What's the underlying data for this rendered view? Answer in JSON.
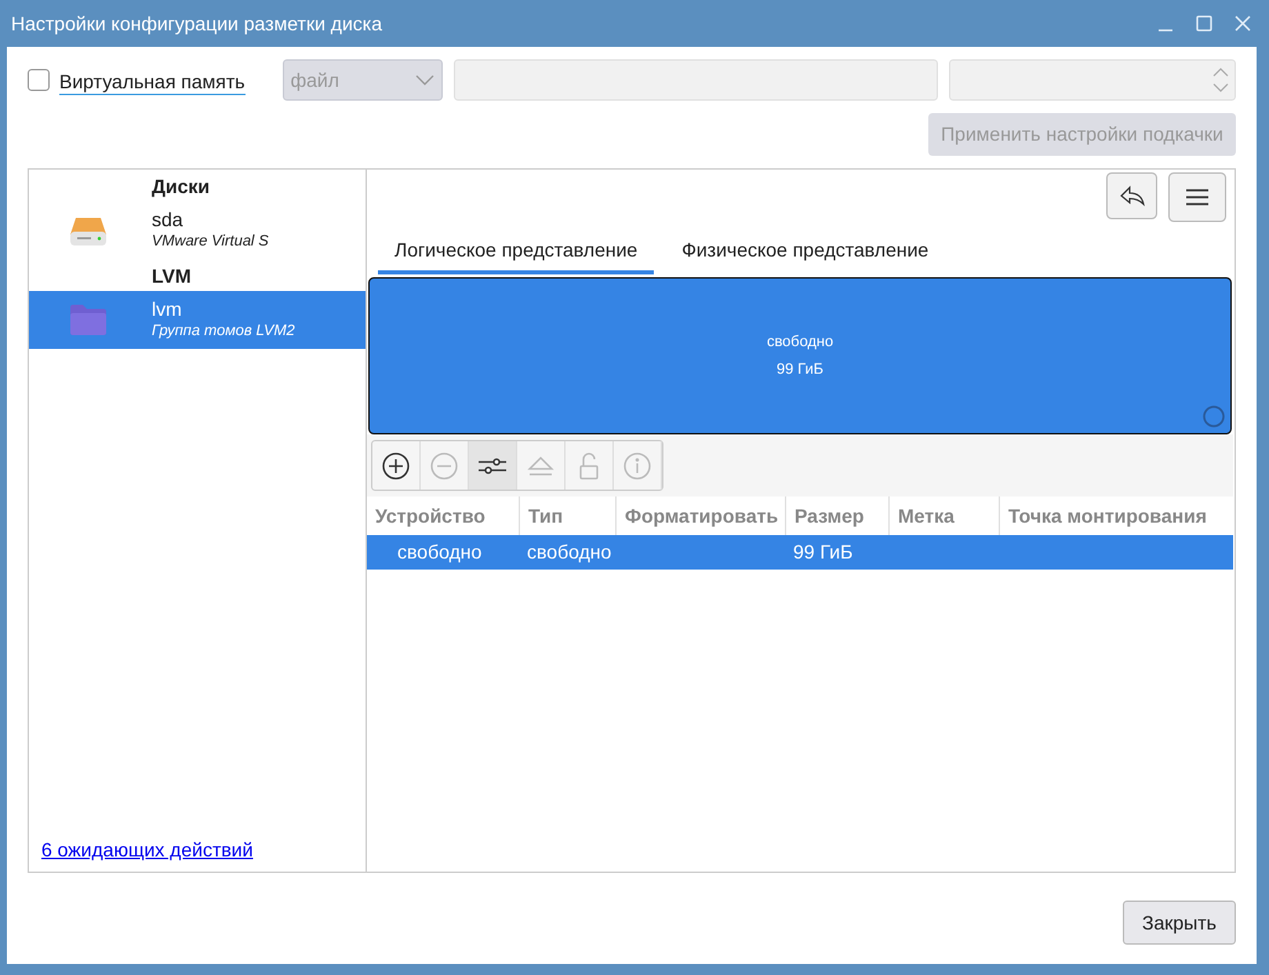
{
  "window": {
    "title": "Настройки конфигурации разметки диска"
  },
  "swap": {
    "checked": false,
    "label": "Виртуальная память",
    "type_select": {
      "value": "файл",
      "disabled": true
    },
    "path_field": {
      "disabled": true
    },
    "size_field": {
      "disabled": true
    },
    "apply_button": {
      "label": "Применить настройки подкачки",
      "disabled": true
    }
  },
  "sidebar": {
    "groups": [
      {
        "title": "Диски",
        "items": [
          {
            "name": "sda",
            "subtitle": "VMware Virtual S",
            "kind": "disk",
            "selected": false
          }
        ]
      },
      {
        "title": "LVM",
        "items": [
          {
            "name": "lvm",
            "subtitle": "Группа томов LVM2",
            "kind": "volume-group",
            "selected": true
          }
        ]
      }
    ]
  },
  "pending_link": "6 ожидающих действий",
  "tabs": [
    {
      "label": "Логическое представление",
      "selected": true
    },
    {
      "label": "Физическое представление",
      "selected": false
    }
  ],
  "partition_map": {
    "label": "свободно",
    "size": "99 ГиБ"
  },
  "toolbar": [
    {
      "kind": "add",
      "disabled": false,
      "pressed": false
    },
    {
      "kind": "remove",
      "disabled": true,
      "pressed": false
    },
    {
      "kind": "settings",
      "disabled": false,
      "pressed": true
    },
    {
      "kind": "eject",
      "disabled": true,
      "pressed": false
    },
    {
      "kind": "unlock",
      "disabled": true,
      "pressed": false
    },
    {
      "kind": "info",
      "disabled": true,
      "pressed": false
    }
  ],
  "table": {
    "columns": [
      "Устройство",
      "Тип",
      "Форматировать",
      "Размер",
      "Метка",
      "Точка монтирования"
    ],
    "rows": [
      {
        "selected": true,
        "cells": [
          "свободно",
          "свободно",
          "",
          "99 ГиБ",
          "",
          ""
        ]
      }
    ]
  },
  "close_button": "Закрыть"
}
